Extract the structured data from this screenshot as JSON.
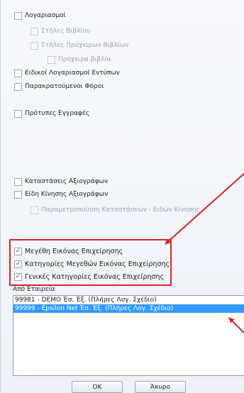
{
  "options": [
    {
      "label": "Λογαριασμοί",
      "checked": false,
      "disabled": false
    },
    {
      "label": "Στήλες Βιβλίου",
      "checked": false,
      "disabled": true
    },
    {
      "label": "Στήλες Πρόχειρων Βιβλίων",
      "checked": false,
      "disabled": true
    },
    {
      "label": "Πρόχειρα βιβλία",
      "checked": false,
      "disabled": true
    },
    {
      "label": "Ειδικοί Λογαριασμοί Εντύπων",
      "checked": false,
      "disabled": false
    },
    {
      "label": "Παρακρατούμενοι Φόροι",
      "checked": false,
      "disabled": false
    },
    {
      "label": "Πρότυπες Εγγραφές",
      "checked": false,
      "disabled": false
    },
    {
      "label": "Καταστάσεις Αξιογράφων",
      "checked": false,
      "disabled": false
    },
    {
      "label": "Είδη Κίνησης Αξιογράφων",
      "checked": false,
      "disabled": false
    },
    {
      "label": "Παραμετροποίηση Καταστάσεων - Ειδών Κίνησης",
      "checked": false,
      "disabled": true
    },
    {
      "label": "Μεγέθη Εικόνας Επιχείρησης",
      "checked": true,
      "disabled": false
    },
    {
      "label": "Κατηγορίες Μεγεθών Εικόνας Επιχείρησης",
      "checked": true,
      "disabled": false
    },
    {
      "label": "Γενικές Κατηγορίες Εικόνας Επιχείρησης",
      "checked": true,
      "disabled": false
    }
  ],
  "company_section": {
    "label": "Από Εταιρεία",
    "items": [
      {
        "text": "99981 - DEMO Έσ. Έξ. (Πλήρες Λογ. Σχέδιο)",
        "selected": false
      },
      {
        "text": "99999 - Epsilon Net Έσ. Έξ. (Πλήρες Λογ. Σχέδιο)",
        "selected": true
      }
    ]
  },
  "buttons": {
    "ok": "OK",
    "cancel": "Άκυρο"
  },
  "colors": {
    "highlight": "#d9252b",
    "selection": "#3399ff"
  }
}
